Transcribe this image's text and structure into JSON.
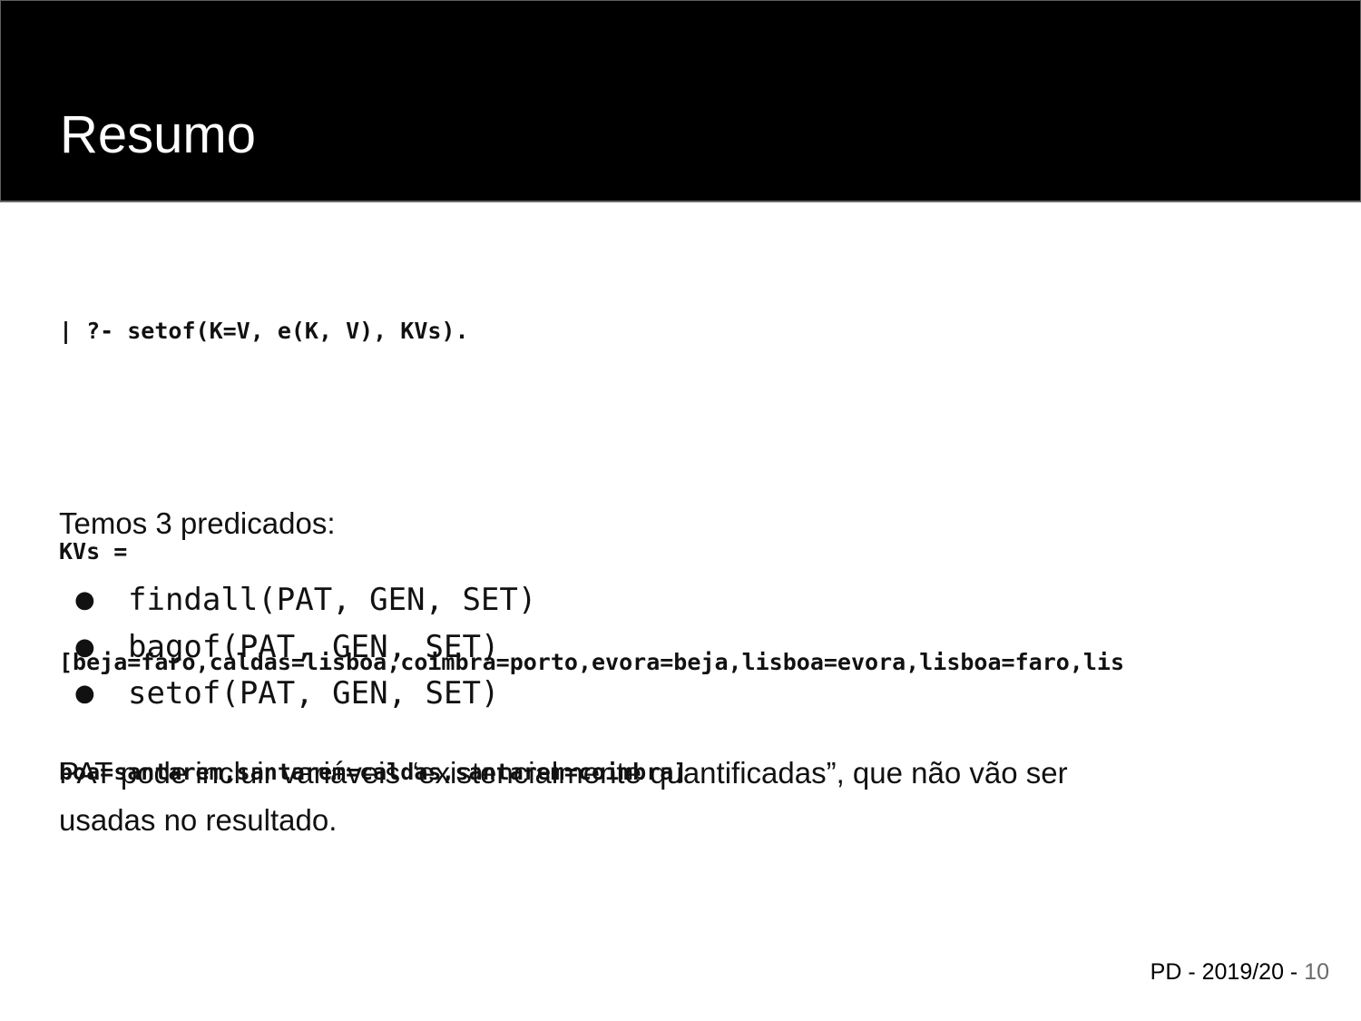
{
  "slide": {
    "title": "Resumo",
    "code_lines": [
      "| ?- setof(K=V, e(K, V), KVs).",
      "",
      "KVs =",
      "[beja=faro,caldas=lisboa,coimbra=porto,evora=beja,lisboa=evora,lisboa=faro,lis",
      "boa=santarem,santarem=caldas,santarem=coimbra]"
    ],
    "intro": "Temos 3 predicados:",
    "bullets": [
      "findall(PAT, GEN, SET)",
      "bagof(PAT, GEN, SET)",
      "setof(PAT, GEN, SET)"
    ],
    "bullet_symbol": "●",
    "paragraph_lines": [
      "PAT pode incluir variáveis “existencialmente quantificadas”, que não vão ser",
      "usadas no resultado."
    ],
    "footer": {
      "label": "PD - 2019/20 - ",
      "page": "10"
    }
  }
}
